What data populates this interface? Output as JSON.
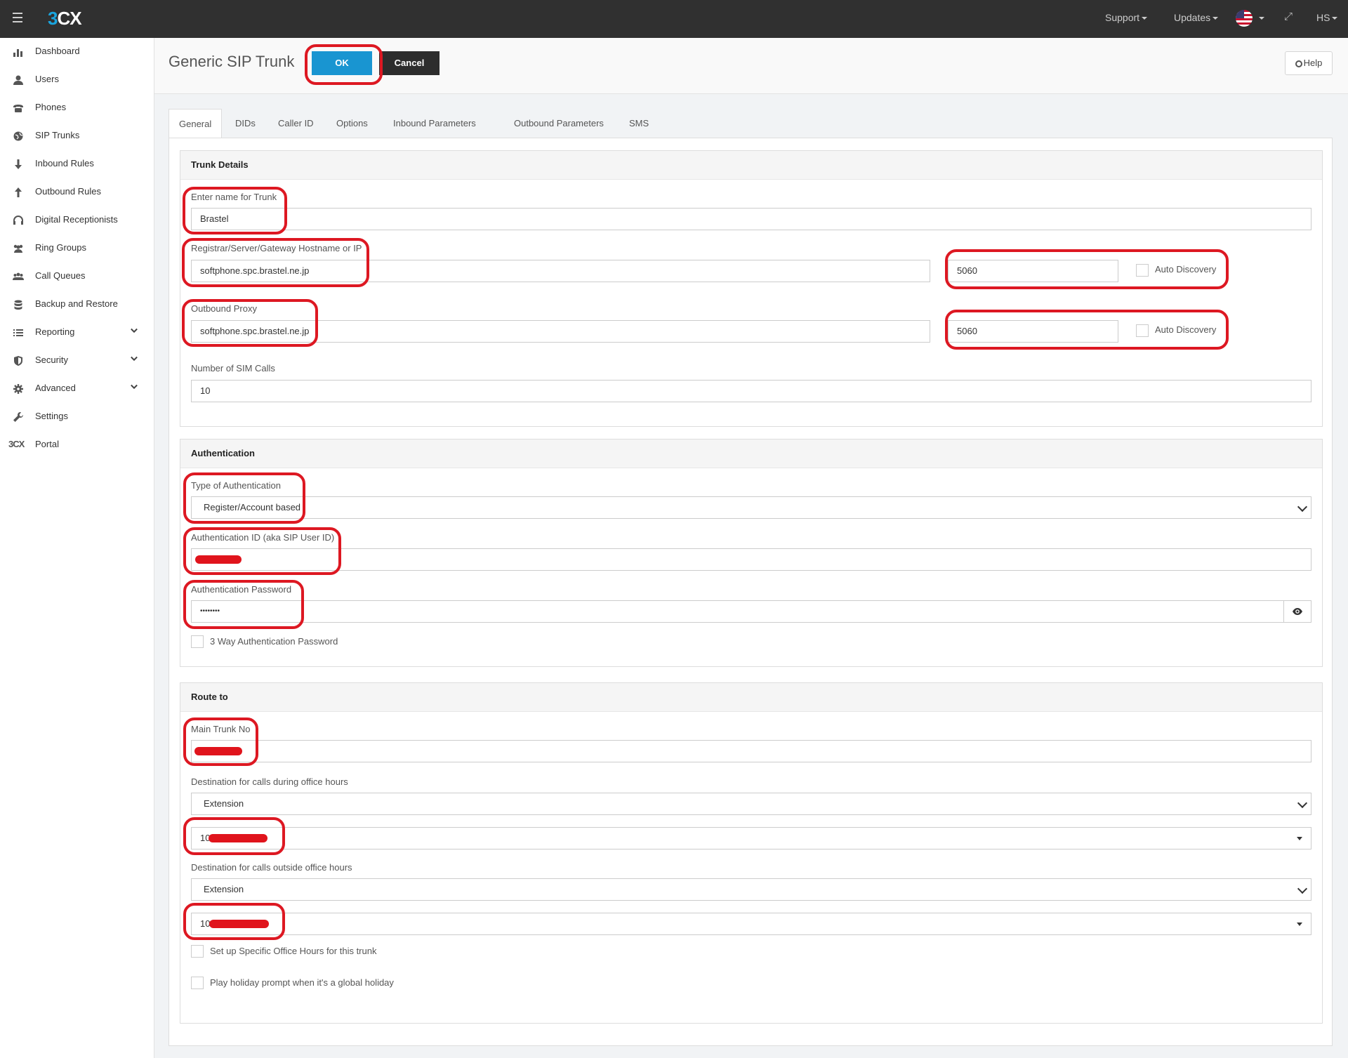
{
  "topbar": {
    "logo_prefix": "3",
    "logo_suffix": "CX",
    "support": "Support",
    "updates": "Updates",
    "user": "HS"
  },
  "sidebar": {
    "items": [
      {
        "label": "Dashboard",
        "icon": "bar-chart-icon"
      },
      {
        "label": "Users",
        "icon": "user-icon"
      },
      {
        "label": "Phones",
        "icon": "phone-icon"
      },
      {
        "label": "SIP Trunks",
        "icon": "globe-icon"
      },
      {
        "label": "Inbound Rules",
        "icon": "arrow-down-icon"
      },
      {
        "label": "Outbound Rules",
        "icon": "arrow-up-icon"
      },
      {
        "label": "Digital Receptionists",
        "icon": "headset-icon"
      },
      {
        "label": "Ring Groups",
        "icon": "group-icon"
      },
      {
        "label": "Call Queues",
        "icon": "queue-icon"
      },
      {
        "label": "Backup and Restore",
        "icon": "database-icon"
      },
      {
        "label": "Reporting",
        "icon": "list-icon"
      },
      {
        "label": "Security",
        "icon": "shield-icon"
      },
      {
        "label": "Advanced",
        "icon": "gear-icon"
      },
      {
        "label": "Settings",
        "icon": "wrench-icon"
      },
      {
        "label": "Portal",
        "icon": "3cx-logo-icon"
      }
    ],
    "portal_logo": "3CX"
  },
  "header": {
    "title": "Generic SIP Trunk",
    "ok": "OK",
    "cancel": "Cancel",
    "help": "Help"
  },
  "tabs": [
    "General",
    "DIDs",
    "Caller ID",
    "Options",
    "Inbound Parameters",
    "Outbound Parameters",
    "SMS"
  ],
  "trunk_details": {
    "heading": "Trunk Details",
    "name_label": "Enter name for Trunk",
    "name_value": "Brastel",
    "registrar_label": "Registrar/Server/Gateway Hostname or IP",
    "registrar_value": "softphone.spc.brastel.ne.jp",
    "registrar_port": "5060",
    "auto_discovery": "Auto Discovery",
    "proxy_label": "Outbound Proxy",
    "proxy_value": "softphone.spc.brastel.ne.jp",
    "proxy_port": "5060",
    "sim_label": "Number of SIM Calls",
    "sim_value": "10"
  },
  "authentication": {
    "heading": "Authentication",
    "type_label": "Type of Authentication",
    "type_value": "Register/Account based",
    "id_label": "Authentication ID (aka SIP User ID)",
    "password_label": "Authentication Password",
    "password_value": "••••••••",
    "three_way_label": "3 Way Authentication Password"
  },
  "route": {
    "heading": "Route to",
    "main_trunk_label": "Main Trunk No",
    "office_hours_label": "Destination for calls during office hours",
    "office_hours_type": "Extension",
    "office_hours_ext_prefix": "10",
    "outside_hours_label": "Destination for calls outside office hours",
    "outside_hours_type": "Extension",
    "outside_hours_ext_prefix": "10",
    "specific_hours_label": "Set up Specific Office Hours for this trunk",
    "holiday_label": "Play holiday prompt when it's a global holiday"
  },
  "colors": {
    "topbar": "#303030",
    "ok_button": "#1995d1",
    "cancel_button": "#2d2d2d",
    "highlight": "#dd1822",
    "redaction": "#e0141c"
  }
}
